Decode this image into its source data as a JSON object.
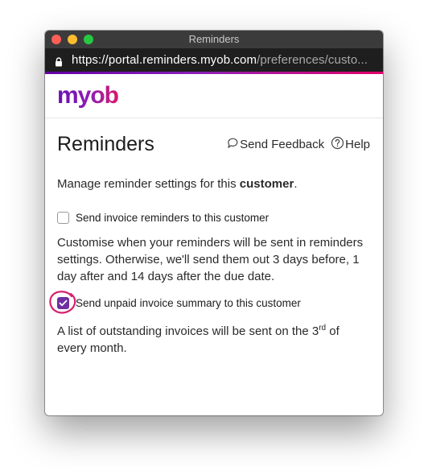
{
  "window": {
    "title": "Reminders",
    "url_host": "https://portal.reminders.myob.com",
    "url_path": "/preferences/custo..."
  },
  "brand": {
    "logo_text": "myob"
  },
  "page": {
    "heading": "Reminders",
    "send_feedback_label": "Send Feedback",
    "help_label": "Help",
    "intro_prefix": "Manage reminder settings for this ",
    "intro_bold": "customer",
    "intro_suffix": "."
  },
  "invoice_reminders": {
    "label": "Send invoice reminders to this customer",
    "checked": false,
    "description": "Customise when your reminders will be sent in reminders settings. Otherwise, we'll send them out 3 days before, 1 day after and 14 days after the due date."
  },
  "summary": {
    "label": "Send unpaid invoice summary to this customer",
    "checked": true,
    "description_prefix": "A list of outstanding invoices will be sent on the 3",
    "description_sup": "rd",
    "description_suffix": " of every month."
  },
  "colors": {
    "accent": "#6f2ea3",
    "highlight_circle": "#d6216f"
  },
  "icons": {
    "lock": "lock-icon",
    "feedback": "speech-bubble-icon",
    "help": "question-circle-icon",
    "check": "checkmark-icon"
  }
}
